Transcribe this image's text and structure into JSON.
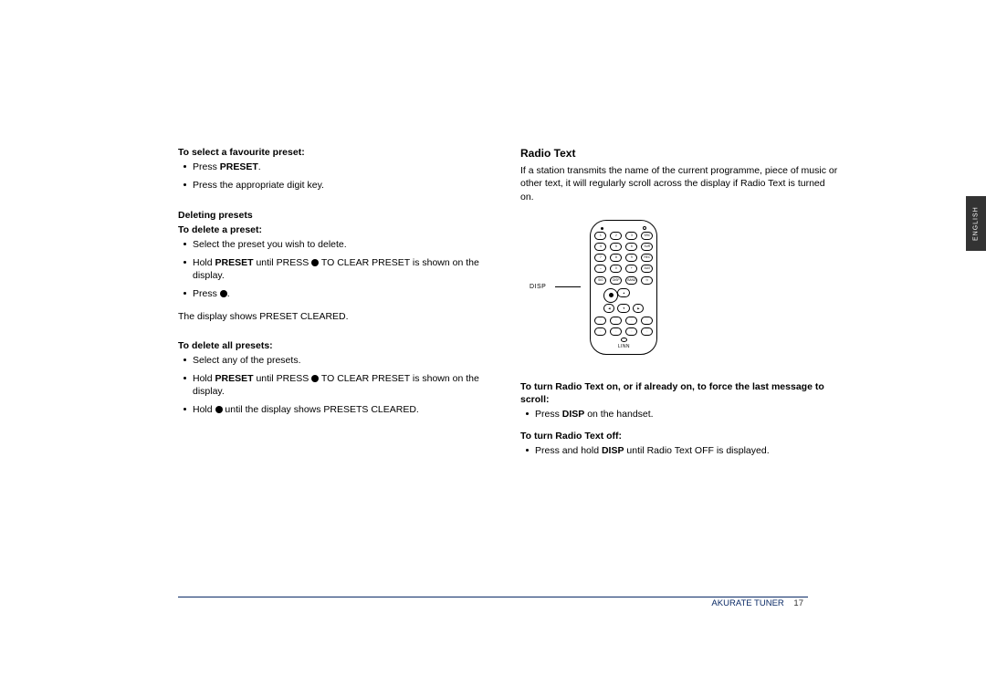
{
  "leftColumn": {
    "selectPresetHeading": "To select a favourite preset:",
    "selectPresetItems": [
      {
        "pre": "Press ",
        "bold": "PRESET",
        "post": "."
      },
      {
        "pre": "Press the appropriate digit key.",
        "bold": "",
        "post": ""
      }
    ],
    "deletingPresetsHeading": "Deleting presets",
    "deletePresetHeading": "To delete a preset:",
    "deletePresetItems": {
      "i1": "Select the preset you wish to delete.",
      "i2_pre": "Hold ",
      "i2_bold": "PRESET",
      "i2_mid": " until PRESS ",
      "i2_post": " TO CLEAR PRESET is shown on the display.",
      "i3_pre": "Press ",
      "i3_post": "."
    },
    "displayShows": "The display shows PRESET CLEARED.",
    "deleteAllHeading": "To delete all presets:",
    "deleteAllItems": {
      "i1": "Select any of the presets.",
      "i2_pre": "Hold ",
      "i2_bold": "PRESET",
      "i2_mid": " until PRESS ",
      "i2_post": " TO CLEAR PRESET is shown on the display.",
      "i3_pre": "Hold ",
      "i3_post": " until the display shows PRESETS CLEARED."
    }
  },
  "rightColumn": {
    "title": "Radio Text",
    "intro": "If a station transmits the name of the current programme, piece of music or other text, it will regularly scroll across the display if Radio Text is turned on.",
    "dispLabel": "DISP",
    "turnOnHeading": "To turn Radio Text on, or if already on, to force the last message to scroll:",
    "turnOnItem_pre": "Press ",
    "turnOnItem_bold": "DISP",
    "turnOnItem_post": " on the handset.",
    "turnOffHeading": "To turn Radio Text off:",
    "turnOffItem_pre": "Press and hold ",
    "turnOffItem_bold": "DISP",
    "turnOffItem_post": " until Radio Text OFF is displayed."
  },
  "remote": {
    "row1": [
      "1",
      "2",
      "3",
      "SRC"
    ],
    "row2": [
      "4",
      "5",
      "6",
      "SUR"
    ],
    "row3": [
      "7",
      "8",
      "9",
      "REC"
    ],
    "row4": [
      "–",
      "0",
      "+",
      "AUX"
    ],
    "ctrlRow": [
      "SIG",
      "DISP",
      "BAND",
      "⏻"
    ],
    "bottom1": [
      "◦",
      "◦",
      "◦",
      "◦"
    ],
    "bottom2": [
      "◦",
      "◦",
      "◦",
      "◦"
    ],
    "logo": "LINN"
  },
  "sideTab": "ENGLISH",
  "footer": {
    "product": "AKURATE TUNER",
    "page": "17"
  }
}
